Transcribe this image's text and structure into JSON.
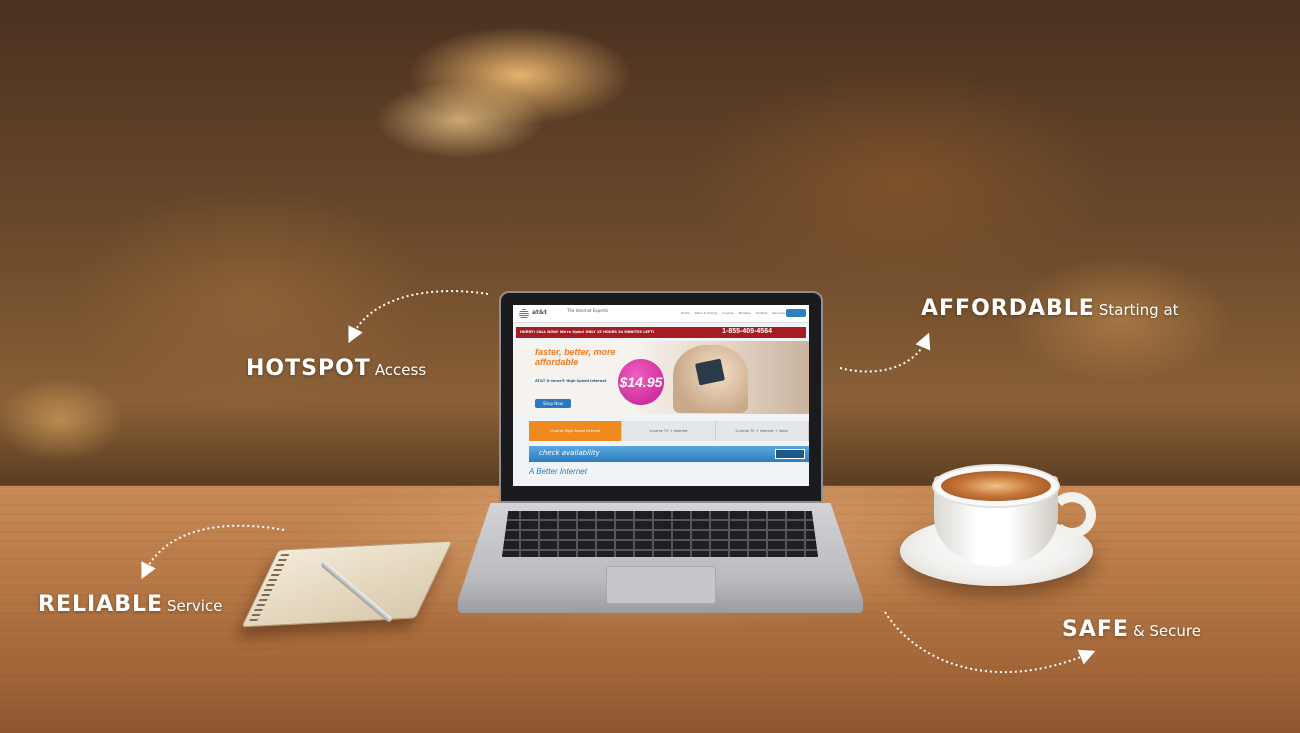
{
  "labels": {
    "hotspot": {
      "strong": "HOTSPOT",
      "light": "Access"
    },
    "affordable": {
      "strong": "AFFORDABLE",
      "light": "Starting at"
    },
    "reliable": {
      "strong": "RELIABLE",
      "light": "Service"
    },
    "safe": {
      "strong": "SAFE",
      "light": "& Secure"
    }
  },
  "laptop_site": {
    "brand": "at&t",
    "tagline": "The Internet Experts",
    "nav": [
      "Home",
      "Plans & Pricing",
      "U-verse",
      "Bundles",
      "Contact",
      "Services"
    ],
    "callbar": "HURRY! CALL NOW! We're Open! ONLY 15 HOURS 34 MINUTES LEFT!",
    "phone": "1-855-409-4564",
    "headline": "faster, better, more affordable",
    "subheadline": "AT&T U-verse® High Speed Internet",
    "shop_button": "Shop Now",
    "price": "$14.95",
    "tabs": [
      "U-verse High Speed Internet",
      "U-verse TV + Internet",
      "U-verse TV + Internet + Voice"
    ],
    "check_availability": "check availability",
    "find_deals": "Find Deals",
    "bottom_heading": "A Better Internet"
  },
  "colors": {
    "label_text": "#ffffff",
    "att_orange": "#ee7b21",
    "att_blue": "#2a78bd",
    "price_magenta": "#c21c8d",
    "callbar_red": "#a51d22"
  }
}
